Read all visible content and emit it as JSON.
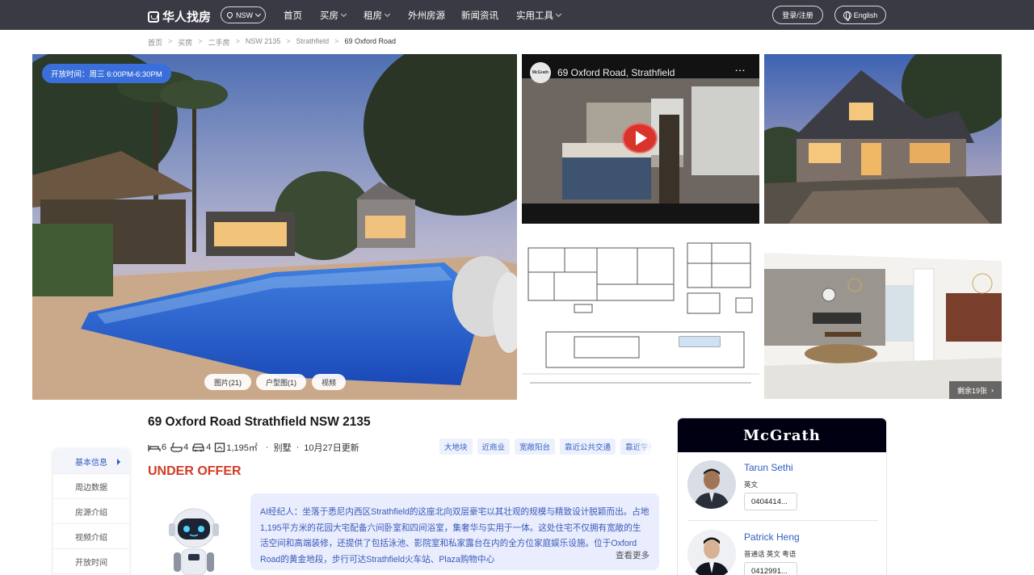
{
  "nav": {
    "brand": "华人找房",
    "state": "NSW",
    "links": [
      "首页",
      "买房",
      "租房",
      "外州房源",
      "新闻资讯",
      "实用工具"
    ],
    "login": "登录/注册",
    "language": "English"
  },
  "breadcrumb": [
    "首页",
    "买房",
    "二手房",
    "NSW 2135",
    "Strathfield",
    "69 Oxford Road"
  ],
  "gallery": {
    "open_time": "开放时间：周三 6:00PM-6:30PM",
    "buttons": [
      "图片(21)",
      "户型图(1)",
      "视频"
    ],
    "video_title": "69 Oxford Road, Strathfield",
    "video_channel_badge": "McGrath",
    "remaining": "剩余19张"
  },
  "listing": {
    "title": "69 Oxford Road Strathfield NSW 2135",
    "bedrooms": "6",
    "bathrooms": "4",
    "parking": "4",
    "land_size": "1,195㎡",
    "property_type": "别墅",
    "updated": "10月27日更新",
    "tags": [
      "大地块",
      "近商业",
      "宽敞阳台",
      "靠近公共交通",
      "靠近学校"
    ],
    "status": "UNDER OFFER"
  },
  "side_menu": [
    "基本信息",
    "周边数据",
    "房源介绍",
    "视频介绍",
    "开放时间"
  ],
  "ai": {
    "text": "AI经纪人：坐落于悉尼内西区Strathfield的这座北向双层豪宅以其壮观的规模与精致设计脱颖而出。占地1,195平方米的花园大宅配备六间卧室和四间浴室，集奢华与实用于一体。这处住宅不仅拥有宽敞的生活空间和高端装修，还提供了包括泳池、影院室和私家露台在内的全方位家庭娱乐设施。位于Oxford Road的黄金地段，步行可达Strathfield火车站、Plaza购物中心",
    "more": "查看更多"
  },
  "agency": {
    "name": "McGrath",
    "agents": [
      {
        "name": "Tarun Sethi",
        "languages": "英文",
        "phone": "0404414..."
      },
      {
        "name": "Patrick Heng",
        "languages": "普通话  英文  粤语",
        "phone": "0412991..."
      }
    ]
  }
}
